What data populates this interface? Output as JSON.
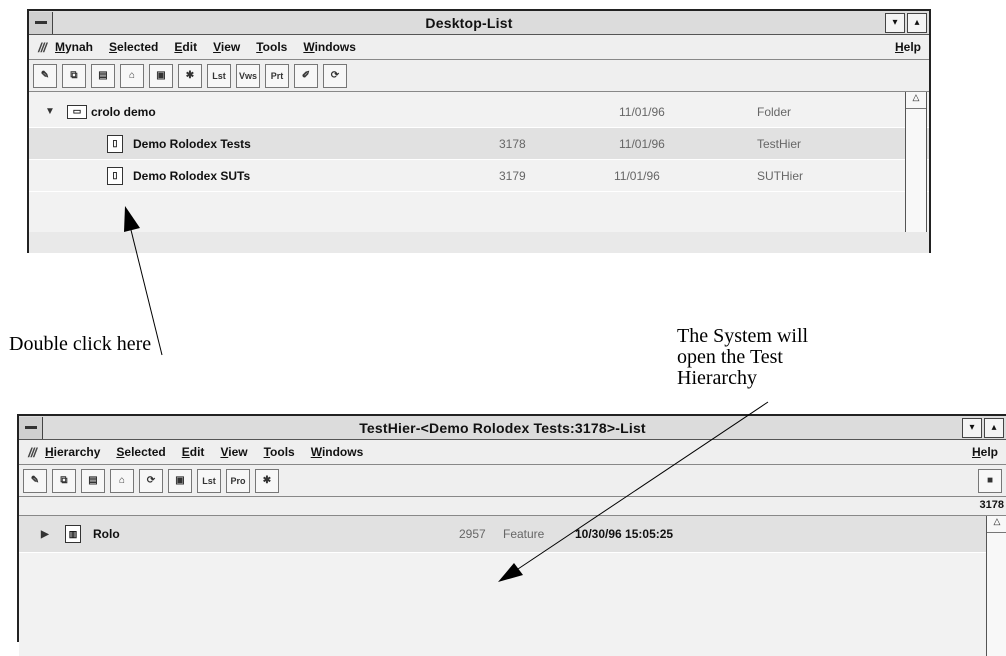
{
  "window1": {
    "title": "Desktop-List",
    "menu": [
      "Mynah",
      "Selected",
      "Edit",
      "View",
      "Tools",
      "Windows"
    ],
    "help": "Help",
    "toolbar_text_buttons": [
      "Lst",
      "Vws",
      "Prt"
    ],
    "rows": [
      {
        "name": "crolo demo",
        "num": "",
        "date": "11/01/96",
        "type": "Folder"
      },
      {
        "name": "Demo Rolodex Tests",
        "num": "3178",
        "date": "11/01/96",
        "type": "TestHier"
      },
      {
        "name": "Demo Rolodex SUTs",
        "num": "3179",
        "date": "11/01/96",
        "type": "SUTHier"
      }
    ]
  },
  "window2": {
    "title": "TestHier-<Demo Rolodex Tests:3178>-List",
    "menu": [
      "Hierarchy",
      "Selected",
      "Edit",
      "View",
      "Tools",
      "Windows"
    ],
    "help": "Help",
    "toolbar_text_buttons": [
      "Lst",
      "Pro"
    ],
    "status_number": "3178",
    "rows": [
      {
        "name": "Rolo",
        "num": "2957",
        "type": "Feature",
        "datetime": "10/30/96 15:05:25"
      }
    ]
  },
  "annotations": {
    "double_click": "Double click here",
    "system_open_line1": "The System will",
    "system_open_line2": "open the Test",
    "system_open_line3": "Hierarchy"
  }
}
